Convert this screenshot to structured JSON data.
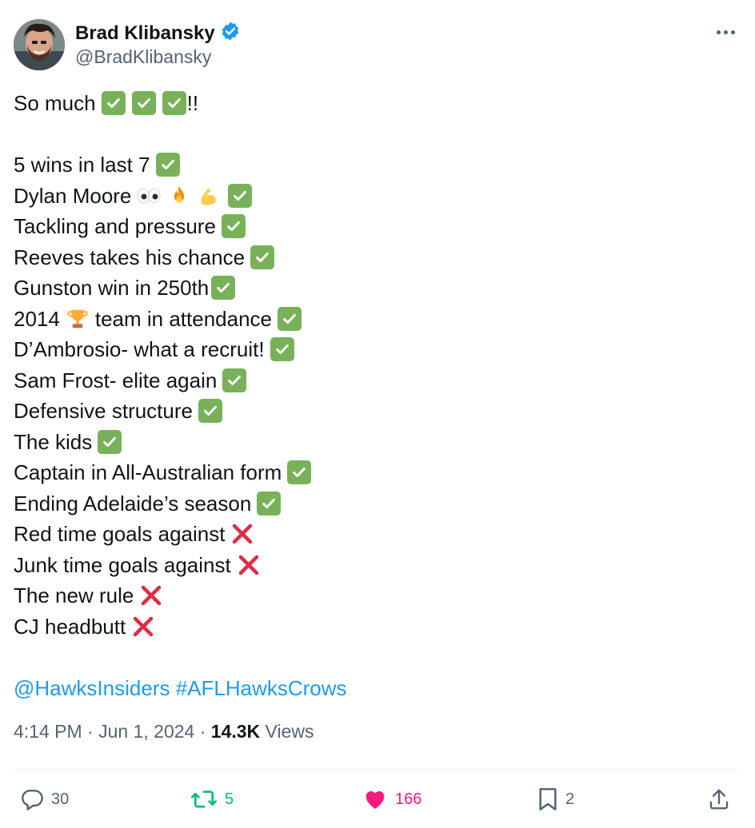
{
  "author": {
    "display_name": "Brad Klibansky",
    "handle": "@BradKlibansky",
    "verified": true
  },
  "tweet": {
    "lines": [
      {
        "text": "So much",
        "emojis": [
          "check-mark",
          "check-mark",
          "check-mark"
        ],
        "suffix": "!!"
      },
      {
        "blank": true
      },
      {
        "text": "5 wins in last 7",
        "emojis": [
          "check-mark"
        ]
      },
      {
        "text": "Dylan Moore",
        "emojis": [
          "eyes",
          "fire",
          "flexed-biceps",
          "check-mark"
        ]
      },
      {
        "text": "Tackling and pressure",
        "emojis": [
          "check-mark"
        ]
      },
      {
        "text": "Reeves takes his chance",
        "emojis": [
          "check-mark"
        ]
      },
      {
        "text": "Gunston win in 250th",
        "emojis": [
          "check-mark"
        ],
        "tight": true
      },
      {
        "text": "2014",
        "emojis": [
          "trophy"
        ],
        "after": "team in attendance",
        "after_emojis": [
          "check-mark"
        ]
      },
      {
        "text": "D’Ambrosio- what a recruit!",
        "emojis": [
          "check-mark"
        ]
      },
      {
        "text": "Sam Frost- elite again",
        "emojis": [
          "check-mark"
        ]
      },
      {
        "text": "Defensive structure",
        "emojis": [
          "check-mark"
        ]
      },
      {
        "text": "The kids",
        "emojis": [
          "check-mark"
        ]
      },
      {
        "text": "Captain in All-Australian form",
        "emojis": [
          "check-mark"
        ]
      },
      {
        "text": "Ending Adelaide’s season",
        "emojis": [
          "check-mark"
        ]
      },
      {
        "text": "Red time goals against",
        "emojis": [
          "cross-mark"
        ]
      },
      {
        "text": "Junk time goals against",
        "emojis": [
          "cross-mark"
        ]
      },
      {
        "text": "The new rule",
        "emojis": [
          "cross-mark"
        ]
      },
      {
        "text": "CJ headbutt",
        "emojis": [
          "cross-mark"
        ]
      },
      {
        "blank": true
      }
    ],
    "mention": "@HawksInsiders",
    "hashtag": "#AFLHawksCrows"
  },
  "meta": {
    "time": "4:14 PM",
    "date": "Jun 1, 2024",
    "views_count": "14.3K",
    "views_label": "Views"
  },
  "actions": {
    "replies": "30",
    "reposts": "5",
    "likes": "166",
    "bookmarks": "2"
  },
  "colors": {
    "link": "#1d9bf0",
    "verified": "#1d9bf0",
    "repost": "#00ba7c",
    "like": "#f91880",
    "check": "#78b159",
    "cross": "#dd2e44",
    "secondary_text": "#536471"
  },
  "icons": [
    "verified-badge-icon",
    "more-icon",
    "reply-icon",
    "repost-icon",
    "like-icon",
    "bookmark-icon",
    "share-icon"
  ]
}
